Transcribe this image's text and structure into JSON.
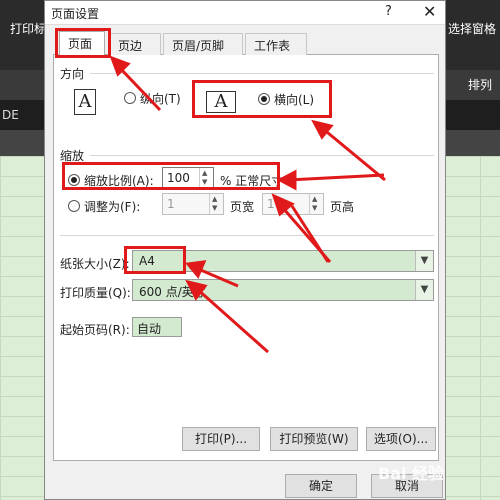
{
  "background": {
    "ribbon_left": "打印标",
    "ribbon_right": "选择窗格",
    "ribbon_group": "排列",
    "namebox_fragment": "DE"
  },
  "dialog": {
    "title": "页面设置",
    "help_glyph": "?",
    "close_glyph": "✕",
    "tabs": [
      "页面",
      "页边距",
      "页眉/页脚",
      "工作表"
    ],
    "orientation": {
      "label": "方向",
      "portrait": "纵向(T)",
      "landscape": "横向(L)",
      "selected": "landscape"
    },
    "scaling": {
      "label": "缩放",
      "adjust_to_label": "缩放比例(A):",
      "adjust_to_value": "100",
      "adjust_to_suffix": "% 正常尺寸",
      "fit_to_label": "调整为(F):",
      "fit_wide_value": "1",
      "fit_wide_suffix": "页宽",
      "fit_tall_value": "1",
      "fit_tall_suffix": "页高",
      "selected": "adjust_to"
    },
    "paper_size": {
      "label": "纸张大小(Z):",
      "value": "A4"
    },
    "print_quality": {
      "label": "打印质量(Q):",
      "value": "600 点/英寸"
    },
    "first_page": {
      "label": "起始页码(R):",
      "value": "自动"
    },
    "buttons": {
      "print": "打印(P)...",
      "preview": "打印预览(W)",
      "options": "选项(O)...",
      "ok": "确定",
      "cancel": "取消"
    }
  },
  "colors": {
    "highlight": "#e0191b",
    "field_green": "#d3ead0"
  },
  "watermark": "Bai 经验"
}
